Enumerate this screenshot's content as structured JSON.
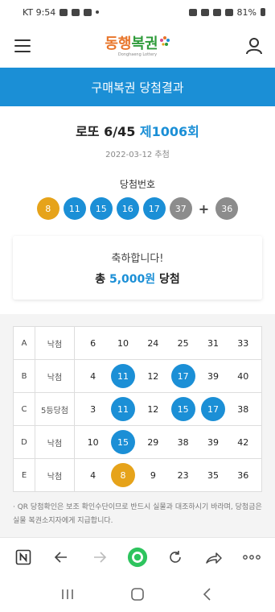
{
  "status_bar": {
    "carrier_time": "KT 9:54",
    "battery": "81%"
  },
  "header": {
    "logo_main_a": "동행",
    "logo_main_b": "복권",
    "logo_sub": "Donghaeng Lottery"
  },
  "title_bar": {
    "title": "구매복권 당첨결과"
  },
  "result": {
    "game": "로또 6/45",
    "round": "제1006회",
    "date": "2022-03-12 추첨",
    "numbers_label": "당첨번호",
    "winning_numbers": [
      {
        "value": "8",
        "color": "#e6a31a"
      },
      {
        "value": "11",
        "color": "#1b8fd6"
      },
      {
        "value": "15",
        "color": "#1b8fd6"
      },
      {
        "value": "16",
        "color": "#1b8fd6"
      },
      {
        "value": "17",
        "color": "#1b8fd6"
      },
      {
        "value": "37",
        "color": "#8c8c8c"
      }
    ],
    "plus_sign": "+",
    "bonus_number": {
      "value": "36",
      "color": "#8c8c8c"
    }
  },
  "congrats": {
    "line1": "축하합니다!",
    "prefix": "총 ",
    "amount": "5,000원",
    "suffix": " 당첨"
  },
  "tickets": [
    {
      "set": "A",
      "result": "낙첨",
      "numbers": [
        {
          "v": "6",
          "hit": false
        },
        {
          "v": "10",
          "hit": false
        },
        {
          "v": "24",
          "hit": false
        },
        {
          "v": "25",
          "hit": false
        },
        {
          "v": "31",
          "hit": false
        },
        {
          "v": "33",
          "hit": false
        }
      ]
    },
    {
      "set": "B",
      "result": "낙첨",
      "numbers": [
        {
          "v": "4",
          "hit": false
        },
        {
          "v": "11",
          "hit": true,
          "color": "#1b8fd6"
        },
        {
          "v": "12",
          "hit": false
        },
        {
          "v": "17",
          "hit": true,
          "color": "#1b8fd6"
        },
        {
          "v": "39",
          "hit": false
        },
        {
          "v": "40",
          "hit": false
        }
      ]
    },
    {
      "set": "C",
      "result": "5등당첨",
      "numbers": [
        {
          "v": "3",
          "hit": false
        },
        {
          "v": "11",
          "hit": true,
          "color": "#1b8fd6"
        },
        {
          "v": "12",
          "hit": false
        },
        {
          "v": "15",
          "hit": true,
          "color": "#1b8fd6"
        },
        {
          "v": "17",
          "hit": true,
          "color": "#1b8fd6"
        },
        {
          "v": "38",
          "hit": false
        }
      ]
    },
    {
      "set": "D",
      "result": "낙첨",
      "numbers": [
        {
          "v": "10",
          "hit": false
        },
        {
          "v": "15",
          "hit": true,
          "color": "#1b8fd6"
        },
        {
          "v": "29",
          "hit": false
        },
        {
          "v": "38",
          "hit": false
        },
        {
          "v": "39",
          "hit": false
        },
        {
          "v": "42",
          "hit": false
        }
      ]
    },
    {
      "set": "E",
      "result": "낙첨",
      "numbers": [
        {
          "v": "4",
          "hit": false
        },
        {
          "v": "8",
          "hit": true,
          "color": "#e6a31a"
        },
        {
          "v": "9",
          "hit": false
        },
        {
          "v": "23",
          "hit": false
        },
        {
          "v": "35",
          "hit": false
        },
        {
          "v": "36",
          "hit": false
        }
      ]
    }
  ],
  "notice": "· QR 당첨확인은 보조 확인수단이므로 반드시 실물과 대조하시기 바라며, 당첨금은 실물 복권소지자에게 지급합니다.",
  "browser_bar": {
    "icons": [
      "n-tab-icon",
      "back-arrow-icon",
      "forward-arrow-icon",
      "home-dot-icon",
      "refresh-icon",
      "share-icon",
      "more-icon"
    ]
  },
  "colors": {
    "accent": "#1b8fd6",
    "yellow_ball": "#e6a31a",
    "gray_ball": "#8c8c8c",
    "green_button": "#2ec45e"
  }
}
